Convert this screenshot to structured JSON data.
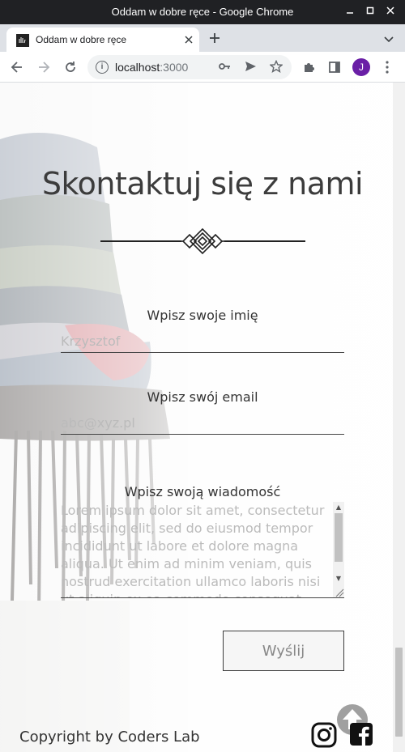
{
  "window": {
    "title": "Oddam w dobre ręce - Google Chrome"
  },
  "tab": {
    "title": "Oddam w dobre ręce",
    "favicon": "hand-logo-icon"
  },
  "address_bar": {
    "host": "localhost",
    "port": ":3000"
  },
  "profile": {
    "initial": "J",
    "color": "#6a1fa6"
  },
  "contact": {
    "heading": "Skontaktuj się z nami",
    "name_label": "Wpisz swoje imię",
    "name_placeholder": "Krzysztof",
    "email_label": "Wpisz swój email",
    "email_placeholder": "abc@xyz.pl",
    "message_label": "Wpisz swoją wiadomość",
    "message_placeholder": "Lorem ipsum dolor sit amet, consectetur adipiscing elit, sed do eiusmod tempor incididunt ut labore et dolore magna aliqua. Ut enim ad minim veniam, quis nostrud exercitation ullamco laboris nisi ut aliquip ex ea commodo consequat.",
    "submit_label": "Wyślij"
  },
  "footer": {
    "copyright": "Copyright by Coders Lab",
    "icons": [
      "arrow-up-icon",
      "instagram-icon",
      "facebook-icon"
    ]
  },
  "colors": {
    "text": "#333333",
    "heading": "#3c3c3c",
    "chrome_dark": "#202124"
  }
}
